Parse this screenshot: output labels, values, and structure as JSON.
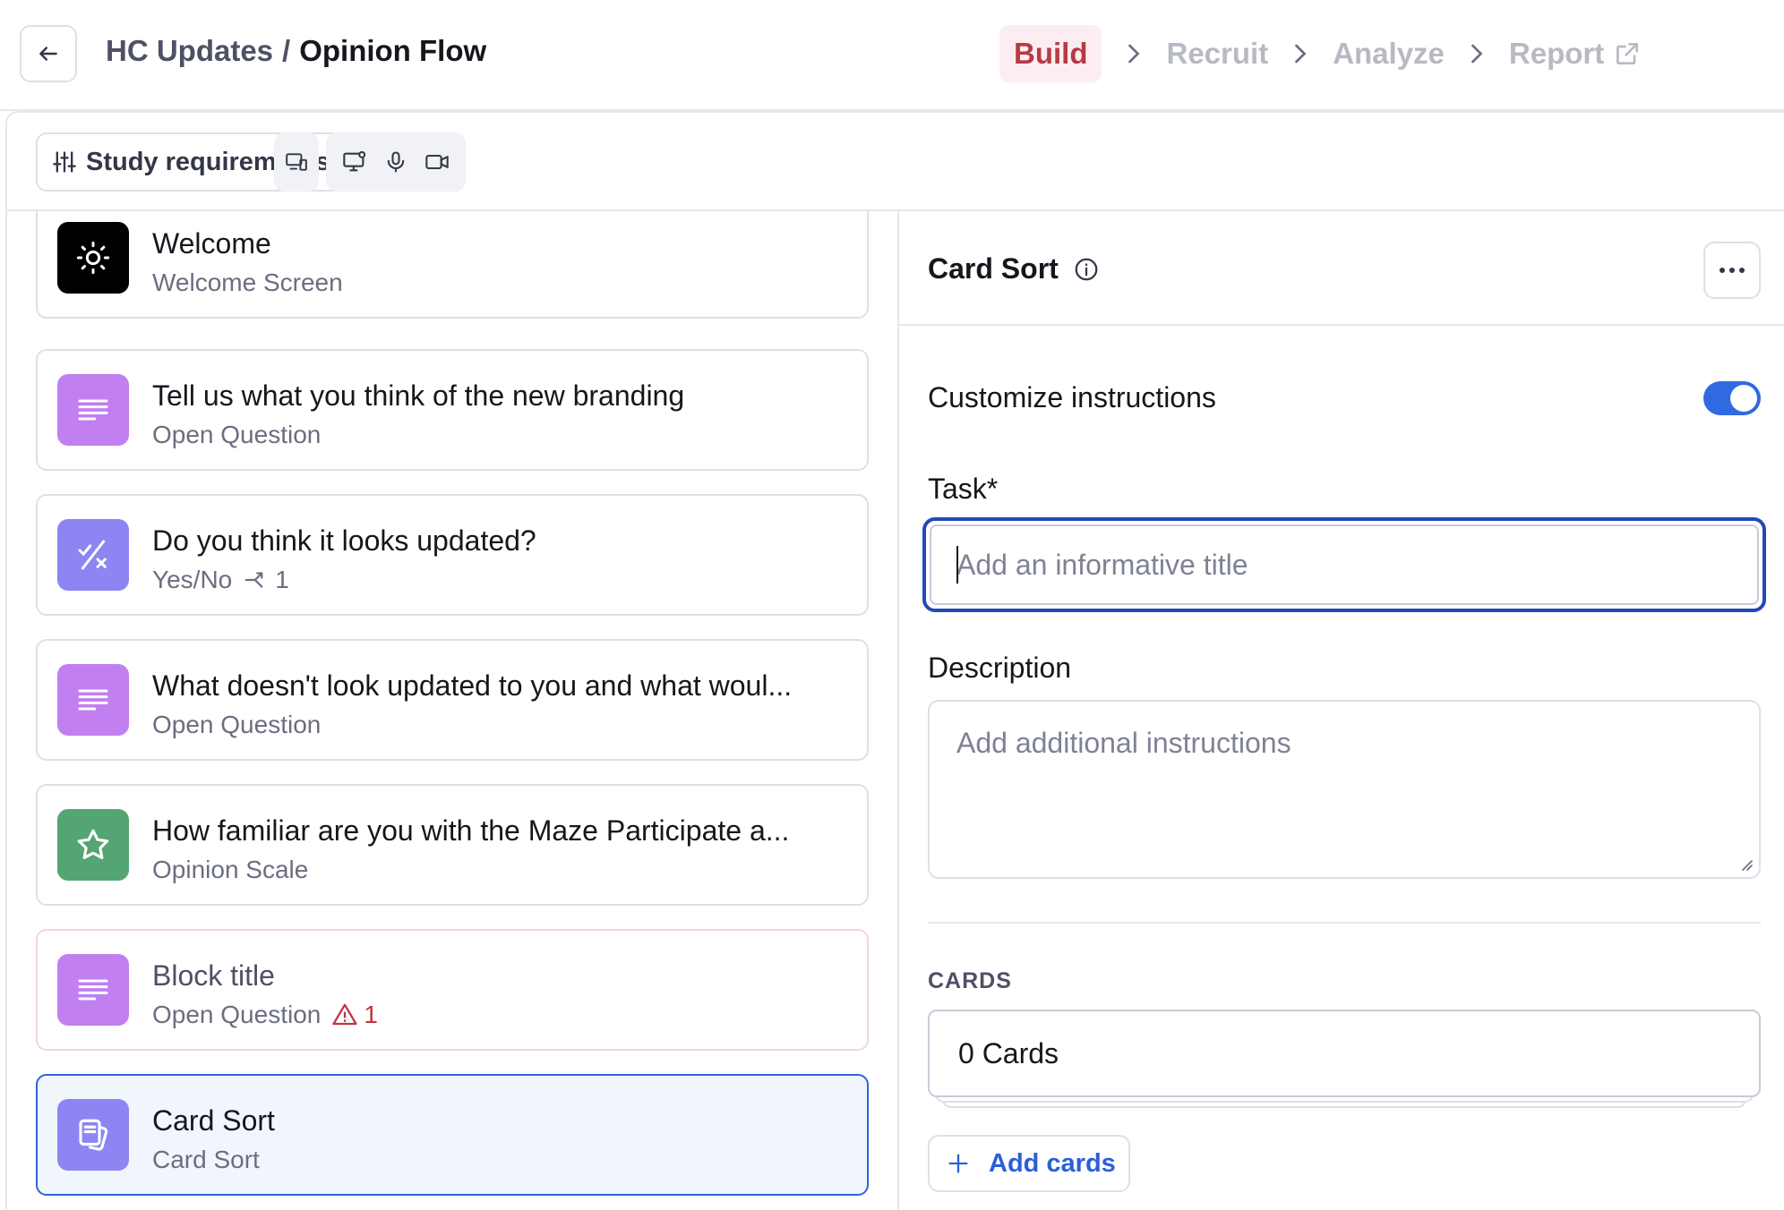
{
  "header": {
    "breadcrumb_parent": "HC Updates",
    "breadcrumb_sep": "/",
    "breadcrumb_current": "Opinion Flow",
    "steps": [
      {
        "label": "Build",
        "state": "active"
      },
      {
        "label": "Recruit",
        "state": "inactive"
      },
      {
        "label": "Analyze",
        "state": "inactive"
      },
      {
        "label": "Report",
        "state": "inactive"
      }
    ]
  },
  "toolbar": {
    "study_requirements_label": "Study requirements"
  },
  "blocks": [
    {
      "title": "Welcome",
      "subtitle": "Welcome Screen",
      "icon": "sun-icon",
      "color": "#000000"
    },
    {
      "title": "Tell us what you think of the new branding",
      "subtitle": "Open Question",
      "icon": "lines-icon",
      "color": "#c17ff0"
    },
    {
      "title": "Do you think it looks updated?",
      "subtitle": "Yes/No",
      "logic_count": "1",
      "icon": "yes-no-icon",
      "color": "#8c85f2"
    },
    {
      "title": "What doesn't look updated to you and what woul...",
      "subtitle": "Open Question",
      "icon": "lines-icon",
      "color": "#c17ff0"
    },
    {
      "title": "How familiar are you with the Maze Participate a...",
      "subtitle": "Opinion Scale",
      "icon": "star-icon",
      "color": "#53a573"
    },
    {
      "title": "Block title",
      "subtitle": "Open Question",
      "warning_count": "1",
      "icon": "lines-icon",
      "color": "#c17ff0"
    },
    {
      "title": "Card Sort",
      "subtitle": "Card Sort",
      "icon": "cards-icon",
      "color": "#8c85f2",
      "selected": true
    }
  ],
  "panel": {
    "title": "Card Sort",
    "customize_label": "Customize instructions",
    "customize_on": true,
    "task_label": "Task*",
    "task_placeholder": "Add an informative title",
    "description_label": "Description",
    "description_placeholder": "Add additional instructions",
    "cards_heading": "CARDS",
    "cards_count": "0 Cards",
    "add_cards_label": "Add cards"
  },
  "colors": {
    "accent": "#2f6ae0",
    "active_step": "#b63a47",
    "warning": "#c2333f"
  }
}
